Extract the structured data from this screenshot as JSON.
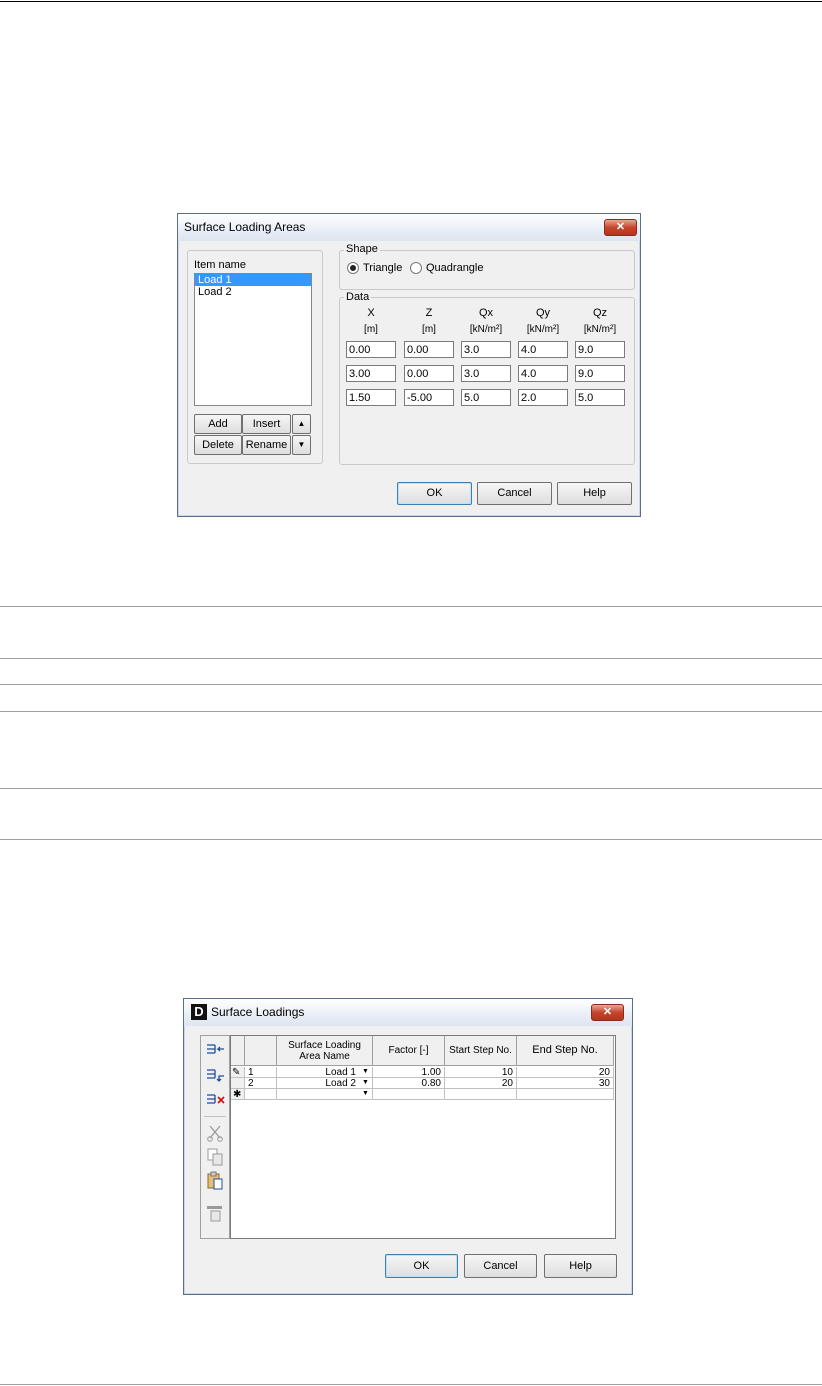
{
  "dialog1": {
    "title": "Surface Loading Areas",
    "item_name_label": "Item name",
    "items": [
      "Load 1",
      "Load 2"
    ],
    "buttons": {
      "add": "Add",
      "insert": "Insert",
      "delete": "Delete",
      "rename": "Rename",
      "up": "▲",
      "down": "▼"
    },
    "shape": {
      "label": "Shape",
      "triangle": "Triangle",
      "quadrangle": "Quadrangle",
      "selected": "Triangle"
    },
    "data": {
      "label": "Data",
      "columns": [
        {
          "name": "X",
          "unit": "[m]"
        },
        {
          "name": "Z",
          "unit": "[m]"
        },
        {
          "name": "Qx",
          "unit": "[kN/m²]"
        },
        {
          "name": "Qy",
          "unit": "[kN/m²]"
        },
        {
          "name": "Qz",
          "unit": "[kN/m²]"
        }
      ],
      "rows": [
        [
          "0.00",
          "0.00",
          "3.0",
          "4.0",
          "9.0"
        ],
        [
          "3.00",
          "0.00",
          "3.0",
          "4.0",
          "9.0"
        ],
        [
          "1.50",
          "-5.00",
          "5.0",
          "2.0",
          "5.0"
        ]
      ]
    },
    "ok": "OK",
    "cancel": "Cancel",
    "help": "Help"
  },
  "dialog2": {
    "title": "Surface Loadings",
    "columns": [
      "Surface Loading Area Name",
      "Factor [-]",
      "Start Step No.",
      "End Step No."
    ],
    "rows": [
      {
        "num": "1",
        "name": "Load 1",
        "factor": "1.00",
        "start": "10",
        "end": "20"
      },
      {
        "num": "2",
        "name": "Load 2",
        "factor": "0.80",
        "start": "20",
        "end": "30"
      }
    ],
    "new_row_marker": "✱",
    "edit_marker": "✎",
    "ok": "OK",
    "cancel": "Cancel",
    "help": "Help"
  }
}
